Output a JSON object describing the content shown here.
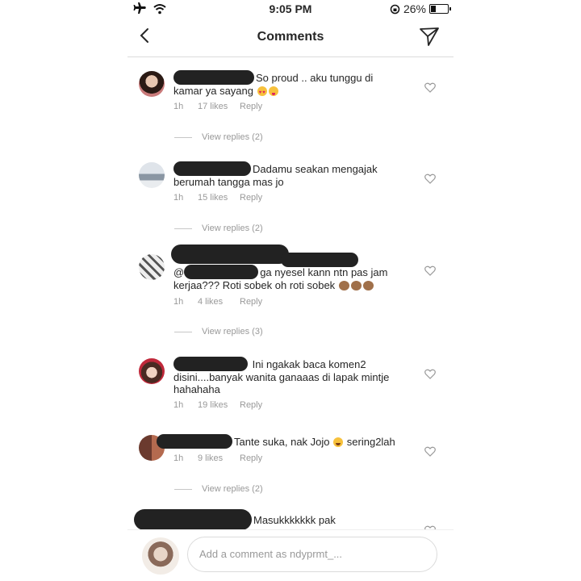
{
  "status_bar": {
    "time": "9:05 PM",
    "battery": "26%",
    "battery_level": 0.26
  },
  "header": {
    "title": "Comments"
  },
  "comments": [
    {
      "text_line1": "So proud .. aku tunggu di",
      "text_line2": "kamar ya sayang",
      "time": "1h",
      "likes": "17 likes",
      "reply": "Reply",
      "replies": "View replies (2)"
    },
    {
      "text_line1": "Dadamu seakan mengajak",
      "text_line2": "berumah tangga mas jo",
      "time": "1h",
      "likes": "15 likes",
      "reply": "Reply",
      "replies": "View replies (2)"
    },
    {
      "text_prefix": "@",
      "text_line1": "ga nyesel kann ntn pas jam",
      "text_line2": "kerjaa??? Roti sobek oh roti sobek",
      "time": "1h",
      "likes": "4 likes",
      "reply": "Reply",
      "replies": "View replies (3)"
    },
    {
      "text_line1": "Ini ngakak baca komen2",
      "text_line2": "disini....banyak wanita ganaaas di lapak mintje",
      "text_line3": "hahahaha",
      "time": "1h",
      "likes": "19 likes",
      "reply": "Reply"
    },
    {
      "text_line1": "Tante suka, nak Jojo",
      "text_after_emoji": "sering2lah",
      "time": "1h",
      "likes": "9 likes",
      "reply": "Reply",
      "replies": "View replies (2)"
    },
    {
      "text_line1": "Masukkkkkkk pak"
    }
  ],
  "composer": {
    "placeholder": "Add a comment as ndyprmt_..."
  },
  "icons": {
    "back": "chevron-left-icon",
    "send": "direct-send-icon",
    "like": "heart-outline-icon",
    "airplane": "airplane-mode-icon",
    "wifi": "wifi-icon",
    "lock": "rotation-lock-icon"
  }
}
